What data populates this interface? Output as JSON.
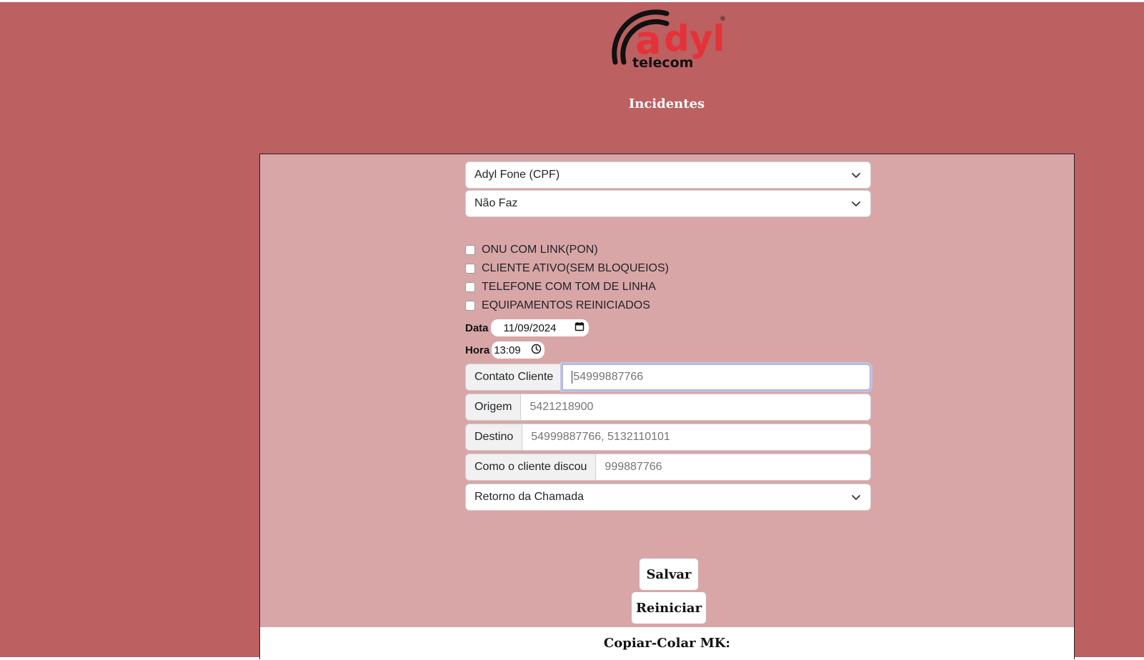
{
  "logo": {
    "word": "adyl",
    "sub": "telecom",
    "registered": "®",
    "brand_color": "#e53238"
  },
  "page_title": "Incidentes",
  "form": {
    "service_select": "Adyl Fone (CPF)",
    "status_select": "Não Faz",
    "checklist": [
      {
        "label": "ONU COM LINK(PON)",
        "checked": false
      },
      {
        "label": "CLIENTE ATIVO(SEM BLOQUEIOS)",
        "checked": false
      },
      {
        "label": "TELEFONE COM TOM DE LINHA",
        "checked": false
      },
      {
        "label": "EQUIPAMENTOS REINICIADOS",
        "checked": false
      }
    ],
    "date_label": "Data",
    "date_value": "11/09/2024",
    "time_label": "Hora",
    "time_value": "13:09",
    "contato": {
      "label": "Contato Cliente",
      "placeholder": "54999887766"
    },
    "origem": {
      "label": "Origem",
      "placeholder": "5421218900"
    },
    "destino": {
      "label": "Destino",
      "placeholder": "54999887766, 5132110101"
    },
    "discou": {
      "label": "Como o cliente discou",
      "placeholder": "999887766"
    },
    "retorno_select": "Retorno da Chamada"
  },
  "buttons": {
    "save": "Salvar",
    "reset": "Reiniciar"
  },
  "copy_section_title": "Copiar-Colar MK:",
  "colors": {
    "page_bg": "#bc6061",
    "panel_bg": "#d9a6a7"
  }
}
